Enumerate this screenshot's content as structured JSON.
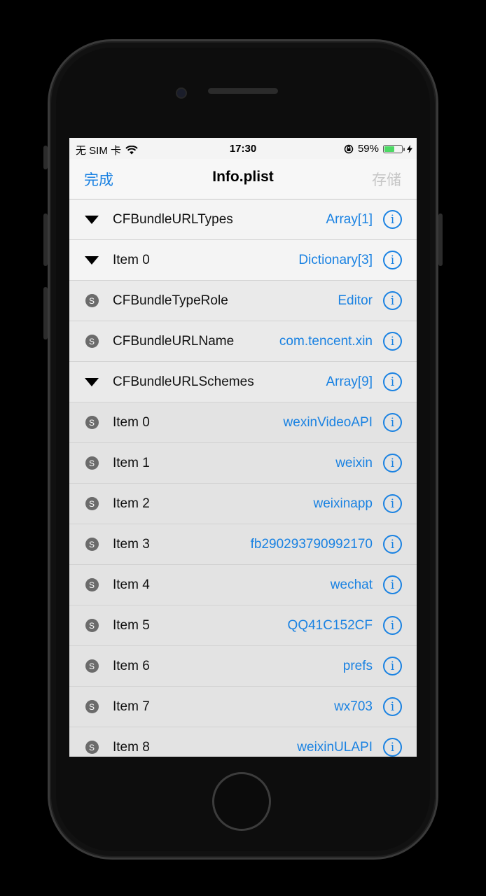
{
  "status": {
    "carrier": "无 SIM 卡",
    "time": "17:30",
    "battery_percent": "59%",
    "battery_level": 0.59
  },
  "nav": {
    "left": "完成",
    "title": "Info.plist",
    "right": "存储"
  },
  "rows": [
    {
      "icon": "triangle",
      "key": "CFBundleURLTypes",
      "value": "Array[1]",
      "depth": 0
    },
    {
      "icon": "triangle",
      "key": "Item 0",
      "value": "Dictionary[3]",
      "depth": 0
    },
    {
      "icon": "string",
      "key": "CFBundleTypeRole",
      "value": "Editor",
      "depth": 1
    },
    {
      "icon": "string",
      "key": "CFBundleURLName",
      "value": "com.tencent.xin",
      "depth": 1
    },
    {
      "icon": "triangle",
      "key": "CFBundleURLSchemes",
      "value": "Array[9]",
      "depth": 1
    },
    {
      "icon": "string",
      "key": "Item 0",
      "value": "wexinVideoAPI",
      "depth": 2
    },
    {
      "icon": "string",
      "key": "Item 1",
      "value": "weixin",
      "depth": 2
    },
    {
      "icon": "string",
      "key": "Item 2",
      "value": "weixinapp",
      "depth": 2
    },
    {
      "icon": "string",
      "key": "Item 3",
      "value": "fb290293790992170",
      "depth": 2
    },
    {
      "icon": "string",
      "key": "Item 4",
      "value": "wechat",
      "depth": 2
    },
    {
      "icon": "string",
      "key": "Item 5",
      "value": "QQ41C152CF",
      "depth": 2
    },
    {
      "icon": "string",
      "key": "Item 6",
      "value": "prefs",
      "depth": 2
    },
    {
      "icon": "string",
      "key": "Item 7",
      "value": "wx703",
      "depth": 2
    },
    {
      "icon": "string",
      "key": "Item 8",
      "value": "weixinULAPI",
      "depth": 2
    }
  ],
  "labels": {
    "string_badge": "S",
    "info_glyph": "i"
  },
  "colors": {
    "accent": "#1a82e2",
    "disabled": "#c6c6c6",
    "battery": "#4cd964"
  }
}
